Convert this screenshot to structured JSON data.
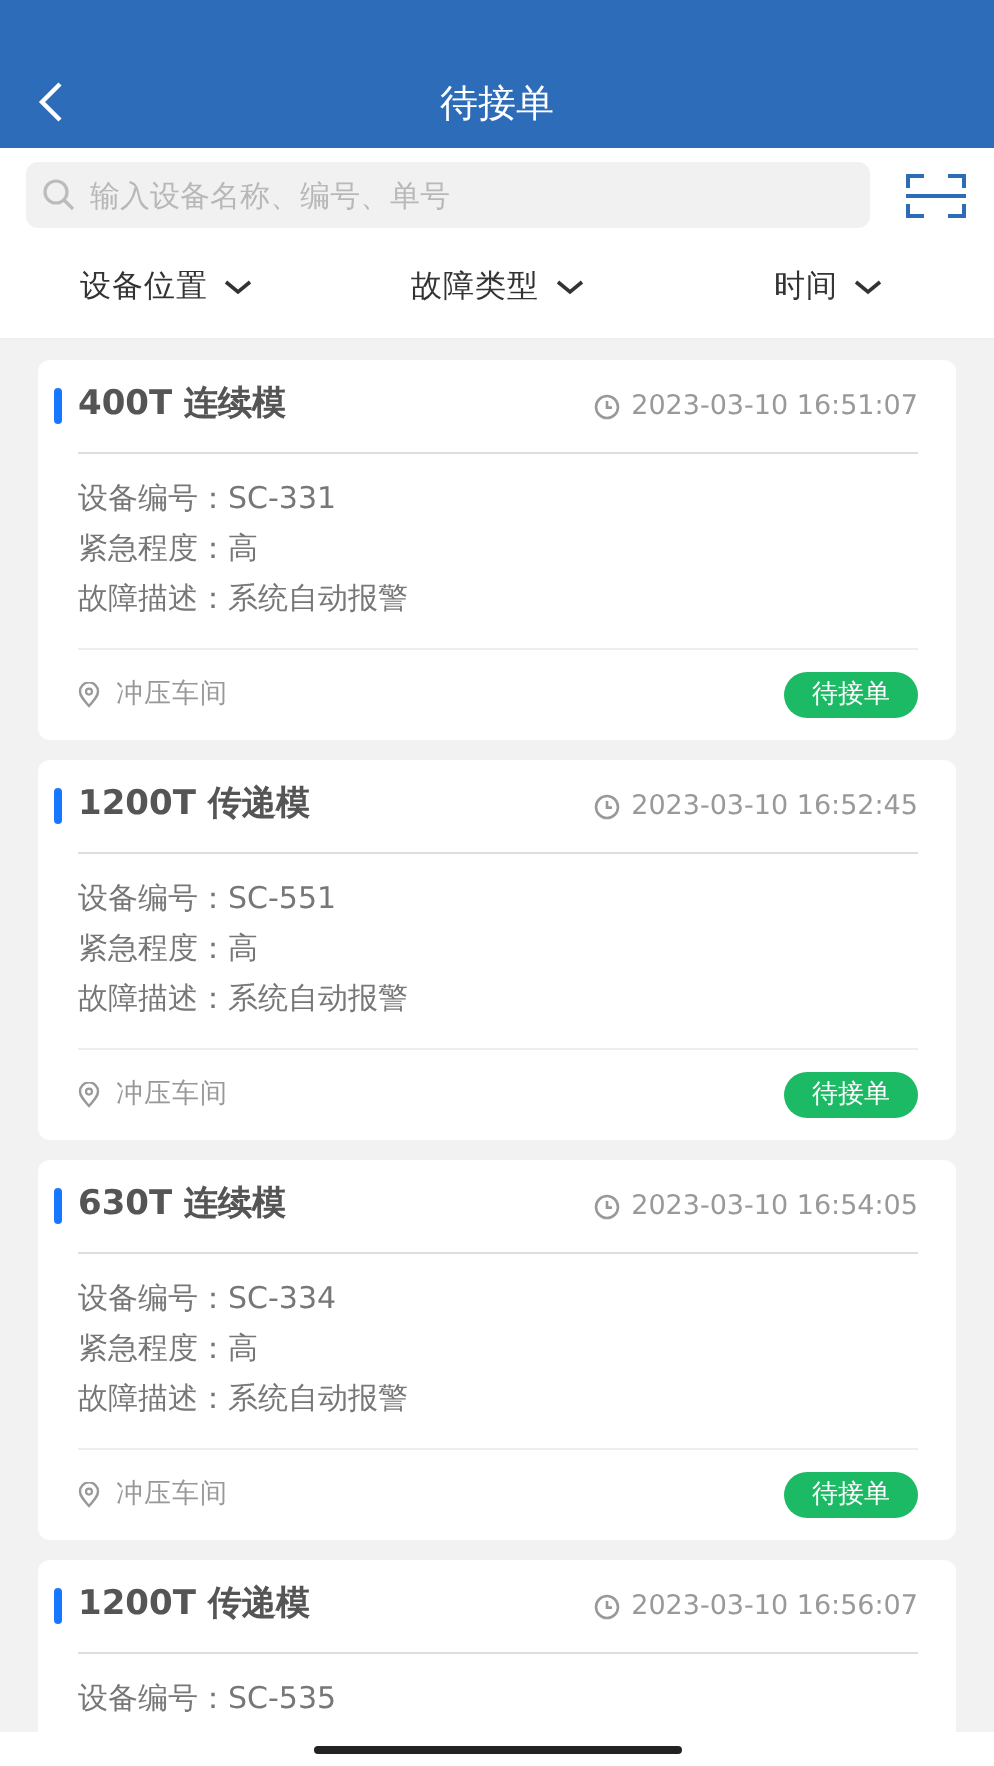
{
  "header": {
    "title": "待接单"
  },
  "search": {
    "placeholder": "输入设备名称、编号、单号"
  },
  "filters": [
    {
      "label": "设备位置"
    },
    {
      "label": "故障类型"
    },
    {
      "label": "时间"
    }
  ],
  "orders": [
    {
      "title": "400T 连续模",
      "time": "2023-03-10 16:51:07",
      "fields": [
        "设备编号：SC-331",
        "紧急程度：高",
        "故障描述：系统自动报警"
      ],
      "location": "冲压车间",
      "status": "待接单"
    },
    {
      "title": "1200T 传递模",
      "time": "2023-03-10 16:52:45",
      "fields": [
        "设备编号：SC-551",
        "紧急程度：高",
        "故障描述：系统自动报警"
      ],
      "location": "冲压车间",
      "status": "待接单"
    },
    {
      "title": "630T 连续模",
      "time": "2023-03-10 16:54:05",
      "fields": [
        "设备编号：SC-334",
        "紧急程度：高",
        "故障描述：系统自动报警"
      ],
      "location": "冲压车间",
      "status": "待接单"
    },
    {
      "title": "1200T 传递模",
      "time": "2023-03-10 16:56:07",
      "fields": [
        "设备编号：SC-535"
      ]
    }
  ]
}
